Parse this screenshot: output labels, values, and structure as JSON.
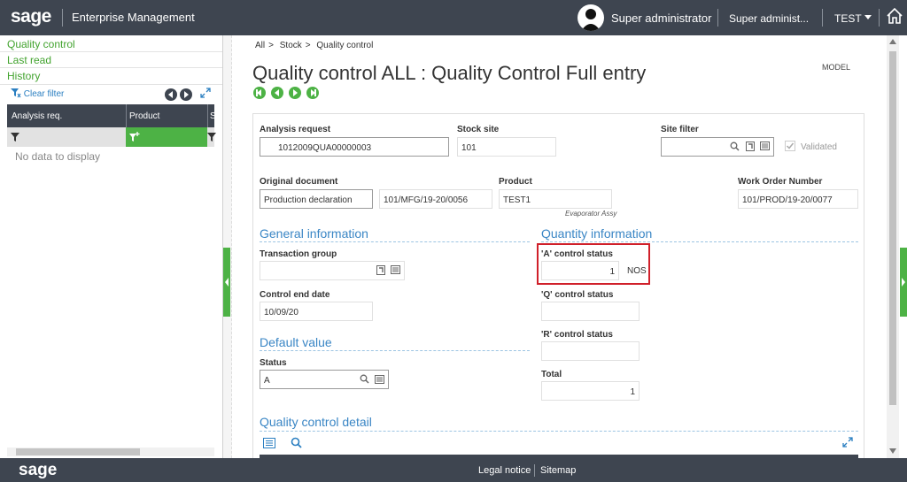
{
  "header": {
    "logo": "sage",
    "app_name": "Enterprise Management",
    "user_name": "Super administrator",
    "role_name": "Super administ...",
    "folder": "TEST"
  },
  "left_panel": {
    "links": [
      "Quality control",
      "Last read",
      "History"
    ],
    "clear_filter": "Clear filter",
    "columns": [
      "Analysis req.",
      "Product",
      "St"
    ],
    "empty_text": "No data to display"
  },
  "main": {
    "breadcrumb": [
      "All",
      "Stock",
      "Quality control"
    ],
    "title": "Quality control ALL : Quality Control Full entry",
    "model": "MODEL",
    "fields": {
      "analysis_request_label": "Analysis request",
      "analysis_request_value": "1012009QUA00000003",
      "stock_site_label": "Stock site",
      "stock_site_value": "101",
      "site_filter_label": "Site filter",
      "site_filter_value": "",
      "validated_label": "Validated",
      "original_document_label": "Original document",
      "original_document_type": "Production declaration",
      "original_document_value": "101/MFG/19-20/0056",
      "product_label": "Product",
      "product_value": "TEST1",
      "product_description": "Evaporator Assy",
      "work_order_label": "Work Order Number",
      "work_order_value": "101/PROD/19-20/0077"
    },
    "general_information": {
      "title": "General information",
      "transaction_group_label": "Transaction group",
      "transaction_group_value": "",
      "control_end_date_label": "Control end date",
      "control_end_date_value": "10/09/20"
    },
    "default_value": {
      "title": "Default value",
      "status_label": "Status",
      "status_value": "A"
    },
    "quantity_information": {
      "title": "Quantity information",
      "a_status_label": "'A' control status",
      "a_status_value": "1",
      "a_status_unit": "NOS",
      "q_status_label": "'Q' control status",
      "q_status_value": "",
      "r_status_label": "'R' control status",
      "r_status_value": "",
      "total_label": "Total",
      "total_value": "1"
    },
    "detail": {
      "title": "Quality control detail"
    }
  },
  "footer": {
    "logo": "sage",
    "legal": "Legal notice",
    "sitemap": "Sitemap"
  },
  "colors": {
    "header_bg": "#3e4550",
    "accent_green": "#4db245",
    "link_green": "#42a32e",
    "section_blue": "#3a86c5",
    "highlight_red": "#d0202a"
  }
}
